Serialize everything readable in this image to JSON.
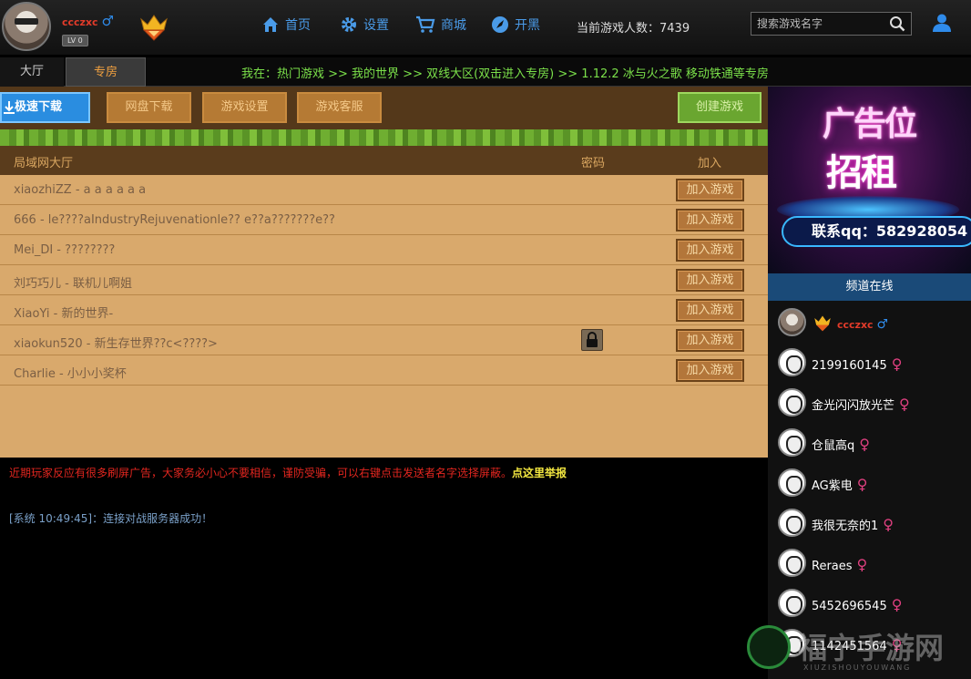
{
  "user": {
    "name": "ccczxc",
    "gender": "♂",
    "level": "LV 0"
  },
  "nav": [
    {
      "icon": "home-icon",
      "label": "首页"
    },
    {
      "icon": "gear-icon",
      "label": "设置"
    },
    {
      "icon": "cart-icon",
      "label": "商城"
    },
    {
      "icon": "rocket-icon",
      "label": "开黑"
    }
  ],
  "online": {
    "label": "当前游戏人数：",
    "count": "7439"
  },
  "search": {
    "placeholder": "搜索游戏名字"
  },
  "tabs": [
    "大厅",
    "专房"
  ],
  "marquee": "我在：热门游戏 >> 我的世界 >> 双线大区(双击进入专房) >> 1.12.2 冰与火之歌 移动铁通等专房",
  "toolbar": {
    "fast_download": "极速下载",
    "disk_download": "网盘下载",
    "game_settings": "游戏设置",
    "game_support": "游戏客服",
    "create_game": "创建游戏"
  },
  "table": {
    "headers": {
      "room": "局域网大厅",
      "password": "密码",
      "join": "加入"
    },
    "join_label": "加入游戏",
    "rows": [
      {
        "name": "xiaozhiZZ - a a a a a a",
        "locked": false
      },
      {
        "name": "666 - le????aIndustryRejuvenationle?? e??a???????e??",
        "locked": false
      },
      {
        "name": "Mei_DI - ????????",
        "locked": false
      },
      {
        "name": "刘巧巧儿 - 联机儿啊姐",
        "locked": false
      },
      {
        "name": "XiaoYi - 新的世界-",
        "locked": false
      },
      {
        "name": "xiaokun520 - 新生存世界??c<????>",
        "locked": true
      },
      {
        "name": "Charlie - 小小小奖杯",
        "locked": false
      }
    ]
  },
  "notice": {
    "text": "近期玩家反应有很多刷屏广告，大家务必小心不要相信，谨防受骗，可以右键点击发送者名字选择屏蔽。",
    "report": "点这里举报"
  },
  "system_message": "[系统 10:49:45]：连接对战服务器成功！",
  "ad": {
    "line1": "广告位",
    "line2": "招租",
    "contact": "联系qq：582928054"
  },
  "channel": {
    "title": "频道在线",
    "me": {
      "name": "ccczxc",
      "gender": "♂"
    },
    "users": [
      {
        "name": "2199160145",
        "gender": "♀"
      },
      {
        "name": "金光闪闪放光芒",
        "gender": "♀"
      },
      {
        "name": "仓鼠高q",
        "gender": "♀"
      },
      {
        "name": "AG紫电",
        "gender": "♀"
      },
      {
        "name": "我很无奈的1",
        "gender": "♀"
      },
      {
        "name": "Reraes",
        "gender": "♀"
      },
      {
        "name": "5452696545",
        "gender": "♀"
      },
      {
        "name": "1142451564",
        "gender": "♀"
      }
    ]
  },
  "watermark": {
    "title": "福宁手游网",
    "sub": "XIUZISHOUYOUWANG"
  },
  "colors": {
    "accent_blue": "#4a9be8",
    "username_red": "#e23b2a",
    "marquee_green": "#7be04a",
    "panel_tan": "#d9a96c"
  }
}
